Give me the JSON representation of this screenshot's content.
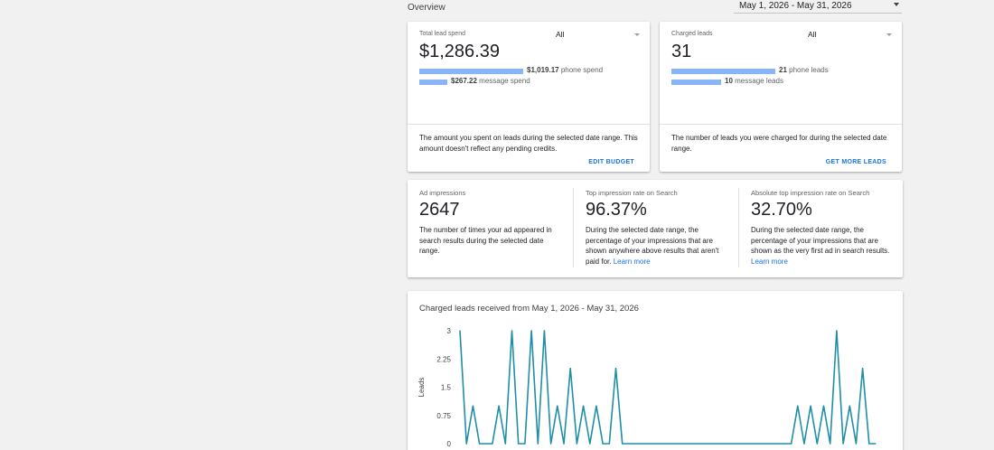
{
  "header": {
    "overview_label": "Overview",
    "date_range": "May 1, 2026 - May 31, 2026"
  },
  "spend_card": {
    "label": "Total lead spend",
    "filter": "All",
    "value": "$1,286.39",
    "bars": [
      {
        "amount": "$1,019.17",
        "suffix": "phone spend",
        "fraction": 1.0
      },
      {
        "amount": "$267.22",
        "suffix": "message spend",
        "fraction": 0.262
      }
    ],
    "description": "The amount you spent on leads during the selected date range. This amount doesn't reflect any pending credits.",
    "action": "EDIT BUDGET"
  },
  "leads_card": {
    "label": "Charged leads",
    "filter": "All",
    "value": "31",
    "bars": [
      {
        "amount": "21",
        "suffix": "phone leads",
        "fraction": 1.0
      },
      {
        "amount": "10",
        "suffix": "message leads",
        "fraction": 0.476
      }
    ],
    "description": "The number of leads you were charged for during the selected date range.",
    "action": "GET MORE LEADS"
  },
  "metrics": [
    {
      "label": "Ad impressions",
      "value": "2647",
      "description": "The number of times your ad appeared in search results during the selected date range.",
      "link": ""
    },
    {
      "label": "Top impression rate on Search",
      "value": "96.37%",
      "description": "During the selected date range, the percentage of your impressions that are shown anywhere above results that aren't paid for.",
      "link": "Learn more"
    },
    {
      "label": "Absolute top impression rate on Search",
      "value": "32.70%",
      "description": "During the selected date range, the percentage of your impressions that are shown as the very first ad in search results.",
      "link": "Learn more"
    }
  ],
  "chart_card": {
    "title": "Charged leads received from May 1, 2026 - May 31, 2026"
  },
  "colors": {
    "accent": "#1a73e8",
    "bar": "#8ab4f8",
    "line": "#1f8fa6"
  },
  "chart_data": {
    "type": "line",
    "title": "Charged leads received from May 1, 2026 - May 31, 2026",
    "xlabel": "",
    "ylabel": "Leads",
    "ylim": [
      0,
      3
    ],
    "yticks": [
      0,
      0.75,
      1.5,
      2.25,
      3
    ],
    "ytick_labels": [
      "0",
      "0.75",
      "1.5",
      "2.25",
      "3"
    ],
    "grid": false,
    "series": [
      {
        "values": [
          3,
          0,
          1,
          0,
          0,
          0,
          1,
          0,
          3,
          0,
          0,
          3,
          0,
          3,
          0,
          1,
          0,
          2,
          0,
          1,
          0,
          1,
          0,
          0,
          2,
          0,
          0,
          0,
          0,
          0,
          0,
          0,
          0,
          0,
          0,
          0,
          0,
          0,
          0,
          0,
          0,
          0,
          0,
          0,
          0,
          0,
          0,
          0,
          0,
          0,
          0,
          0,
          1,
          0,
          1,
          0,
          1,
          0,
          3,
          0,
          1,
          0,
          2,
          0,
          0
        ]
      }
    ]
  }
}
